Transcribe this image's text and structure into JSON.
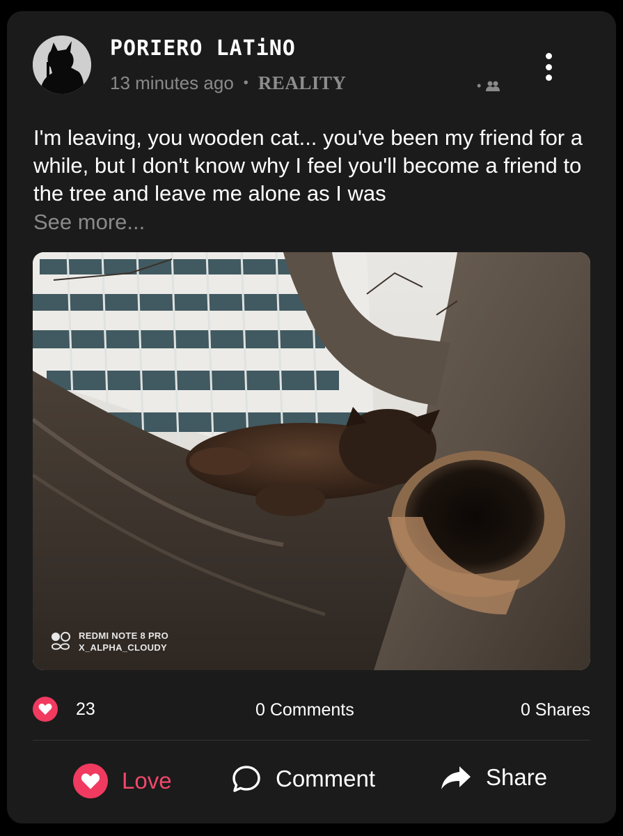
{
  "post": {
    "author": "PORIERO LATiNO",
    "time": "13 minutes ago",
    "separator": "•",
    "category": "REALITY",
    "privacy_dot": "•",
    "text": "I'm leaving, you wooden cat... you've been my friend for a while, but I don't know why I feel you'll become a friend to the tree and leave me alone as I was",
    "see_more": "See more...",
    "photo": {
      "watermark_line1": "REDMI NOTE 8 PRO",
      "watermark_line2": "X_ALPHA_CLOUDY"
    }
  },
  "stats": {
    "likes": "23",
    "comments": "0 Comments",
    "shares": "0 Shares"
  },
  "actions": {
    "love": "Love",
    "comment": "Comment",
    "share": "Share"
  },
  "colors": {
    "accent": "#f03a5f",
    "card_bg": "#1b1b1b",
    "muted_text": "#8a8a8a"
  },
  "icons": [
    "avatar-silhouette",
    "group-icon",
    "more-options-icon",
    "heart-icon",
    "comment-bubble-icon",
    "share-arrow-icon",
    "camera-watermark-icon"
  ]
}
